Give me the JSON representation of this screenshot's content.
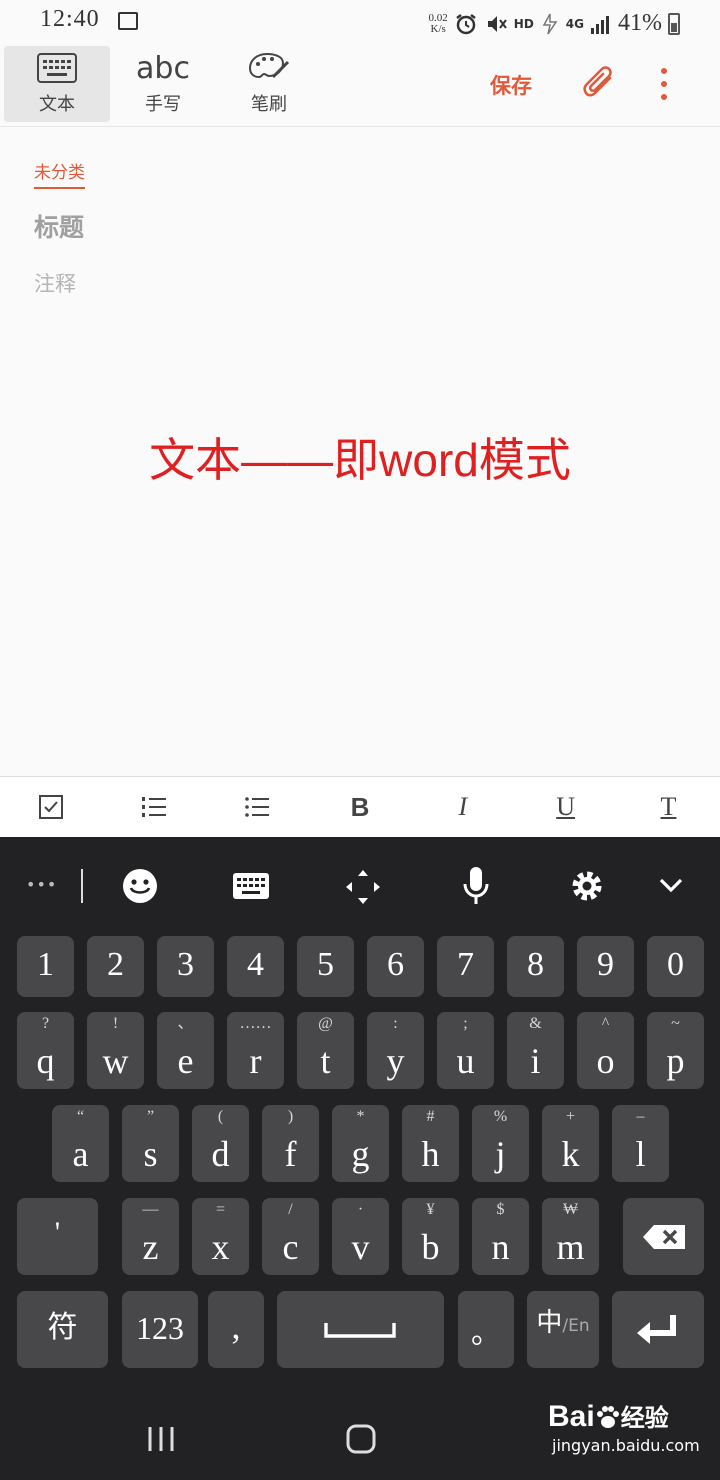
{
  "status": {
    "time": "12:40",
    "speed_top": "0.02",
    "speed_bottom": "K/s",
    "hd": "HD",
    "net": "4G",
    "battery": "41%"
  },
  "toolbar": {
    "modes": [
      {
        "label": "文本",
        "icon": "keyboard-icon",
        "active": true
      },
      {
        "label": "手写",
        "icon": "abc",
        "active": false
      },
      {
        "label": "笔刷",
        "icon": "palette-icon",
        "active": false
      }
    ],
    "save": "保存"
  },
  "note": {
    "category": "未分类",
    "title_placeholder": "标题",
    "comment_placeholder": "注释"
  },
  "annotation": "文本——即word模式",
  "format_bar": [
    "checkbox-icon",
    "numbered-list-icon",
    "bullet-list-icon",
    "B",
    "I",
    "U",
    "T"
  ],
  "keyboard": {
    "numbers": [
      "1",
      "2",
      "3",
      "4",
      "5",
      "6",
      "7",
      "8",
      "9",
      "0"
    ],
    "row1": [
      [
        "q",
        "?"
      ],
      [
        "w",
        "!"
      ],
      [
        "e",
        "、"
      ],
      [
        "r",
        "……"
      ],
      [
        "t",
        "@"
      ],
      [
        "y",
        ":"
      ],
      [
        "u",
        ";"
      ],
      [
        "i",
        "&"
      ],
      [
        "o",
        "^"
      ],
      [
        "p",
        "~"
      ]
    ],
    "row2": [
      [
        "a",
        "“"
      ],
      [
        "s",
        "”"
      ],
      [
        "d",
        "("
      ],
      [
        "f",
        ")"
      ],
      [
        "g",
        "*"
      ],
      [
        "h",
        "#"
      ],
      [
        "j",
        "%"
      ],
      [
        "k",
        "+"
      ],
      [
        "l",
        "–"
      ]
    ],
    "row3": [
      [
        "z",
        "—"
      ],
      [
        "x",
        "="
      ],
      [
        "c",
        "/"
      ],
      [
        "v",
        "·"
      ],
      [
        "b",
        "¥"
      ],
      [
        "n",
        "$"
      ],
      [
        "m",
        "₩"
      ]
    ],
    "apostrophe": "'",
    "symbols": "符",
    "numbers_key": "123",
    "comma": ",",
    "period": "。",
    "lang_main": "中",
    "lang_sub": "/En",
    "ellipsis": "•••"
  },
  "watermark": {
    "brand": "Bai",
    "brand2": "经验",
    "url": "jingyan.baidu.com"
  },
  "colors": {
    "accent": "#e05a3a",
    "annotation": "#e02020",
    "kb_bg": "#222224",
    "key": "#48484a"
  }
}
